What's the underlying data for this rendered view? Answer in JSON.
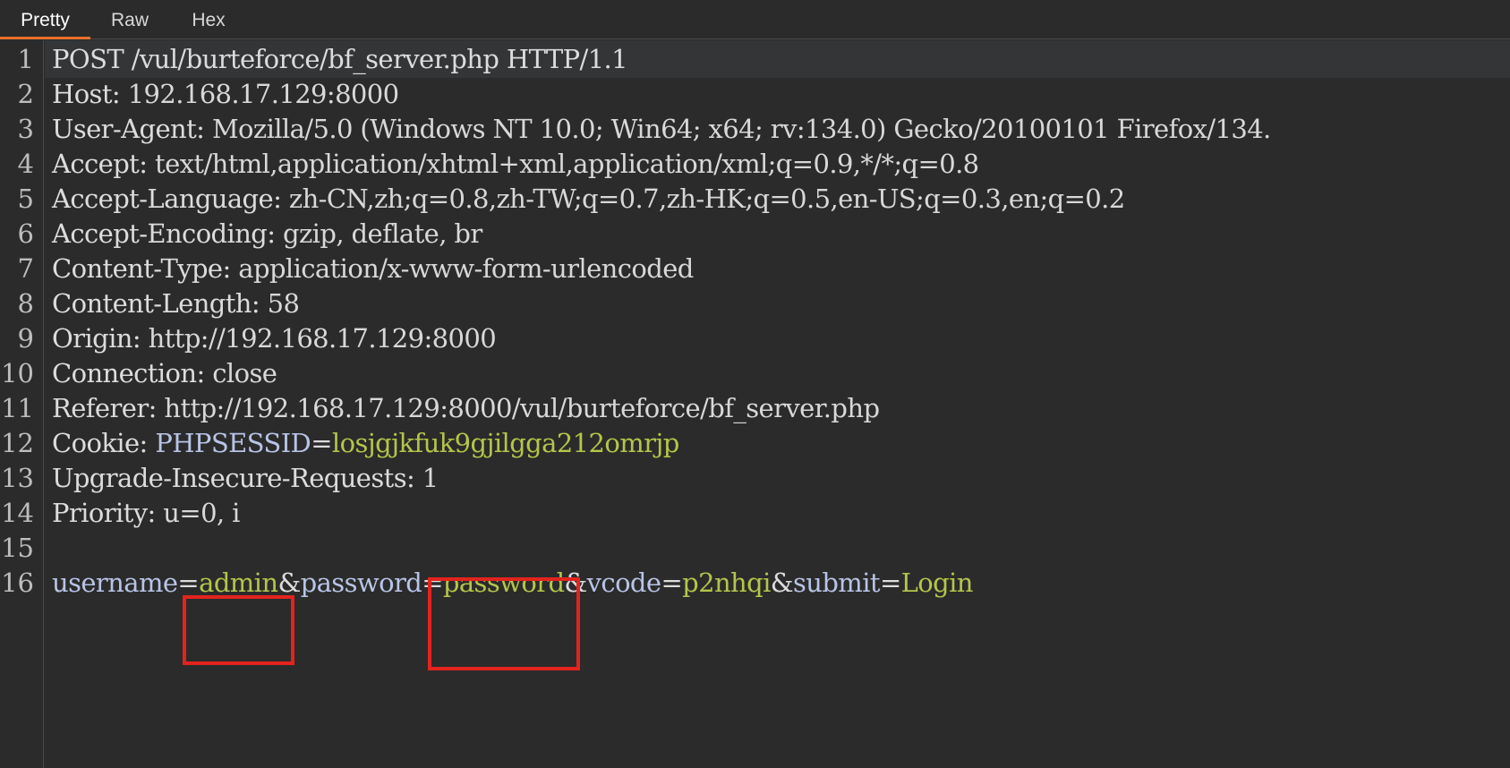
{
  "tabs": [
    {
      "label": "Pretty",
      "active": true
    },
    {
      "label": "Raw",
      "active": false
    },
    {
      "label": "Hex",
      "active": false
    }
  ],
  "lines": [
    {
      "n": "1",
      "key": "POST /vul/burteforce/bf_server.php HTTP/1.1",
      "sep": "",
      "value": ""
    },
    {
      "n": "2",
      "key": "Host",
      "sep": ": ",
      "value": "192.168.17.129:8000"
    },
    {
      "n": "3",
      "key": "User-Agent",
      "sep": ": ",
      "value": "Mozilla/5.0 (Windows NT 10.0; Win64; x64; rv:134.0) Gecko/20100101 Firefox/134."
    },
    {
      "n": "4",
      "key": "Accept",
      "sep": ": ",
      "value": "text/html,application/xhtml+xml,application/xml;q=0.9,*/*;q=0.8"
    },
    {
      "n": "5",
      "key": "Accept-Language",
      "sep": ": ",
      "value": "zh-CN,zh;q=0.8,zh-TW;q=0.7,zh-HK;q=0.5,en-US;q=0.3,en;q=0.2"
    },
    {
      "n": "6",
      "key": "Accept-Encoding",
      "sep": ": ",
      "value": "gzip, deflate, br"
    },
    {
      "n": "7",
      "key": "Content-Type",
      "sep": ": ",
      "value": "application/x-www-form-urlencoded"
    },
    {
      "n": "8",
      "key": "Content-Length",
      "sep": ": ",
      "value": "58"
    },
    {
      "n": "9",
      "key": "Origin",
      "sep": ": ",
      "value": "http://192.168.17.129:8000"
    },
    {
      "n": "10",
      "key": "Connection",
      "sep": ": ",
      "value": "close"
    },
    {
      "n": "11",
      "key": "Referer",
      "sep": ": ",
      "value": "http://192.168.17.129:8000/vul/burteforce/bf_server.php"
    },
    {
      "n": "12",
      "key": "Cookie",
      "sep": ": ",
      "value": ""
    },
    {
      "n": "13",
      "key": "Upgrade-Insecure-Requests",
      "sep": ": ",
      "value": "1"
    },
    {
      "n": "14",
      "key": "Priority",
      "sep": ": ",
      "value": "u=0, i"
    },
    {
      "n": "15",
      "key": "",
      "sep": "",
      "value": ""
    },
    {
      "n": "16",
      "key": "",
      "sep": "",
      "value": ""
    }
  ],
  "cookie": {
    "name": "PHPSESSID",
    "eq": "=",
    "value": "losjgjkfuk9gjilgga212omrjp"
  },
  "body_params": {
    "p1_name": "username",
    "p1_value": "admin",
    "p2_name": "password",
    "p2_value": "password",
    "p3_name": "vcode",
    "p3_value": "p2nhqi",
    "p4_name": "submit",
    "p4_value": "Login",
    "eq": "=",
    "amp": "&"
  },
  "colors": {
    "background": "#2b2b2b",
    "accent_tab": "#e8702a",
    "param_name": "#b8c4e6",
    "param_value": "#b5c54a",
    "highlight": "#e3231e"
  }
}
